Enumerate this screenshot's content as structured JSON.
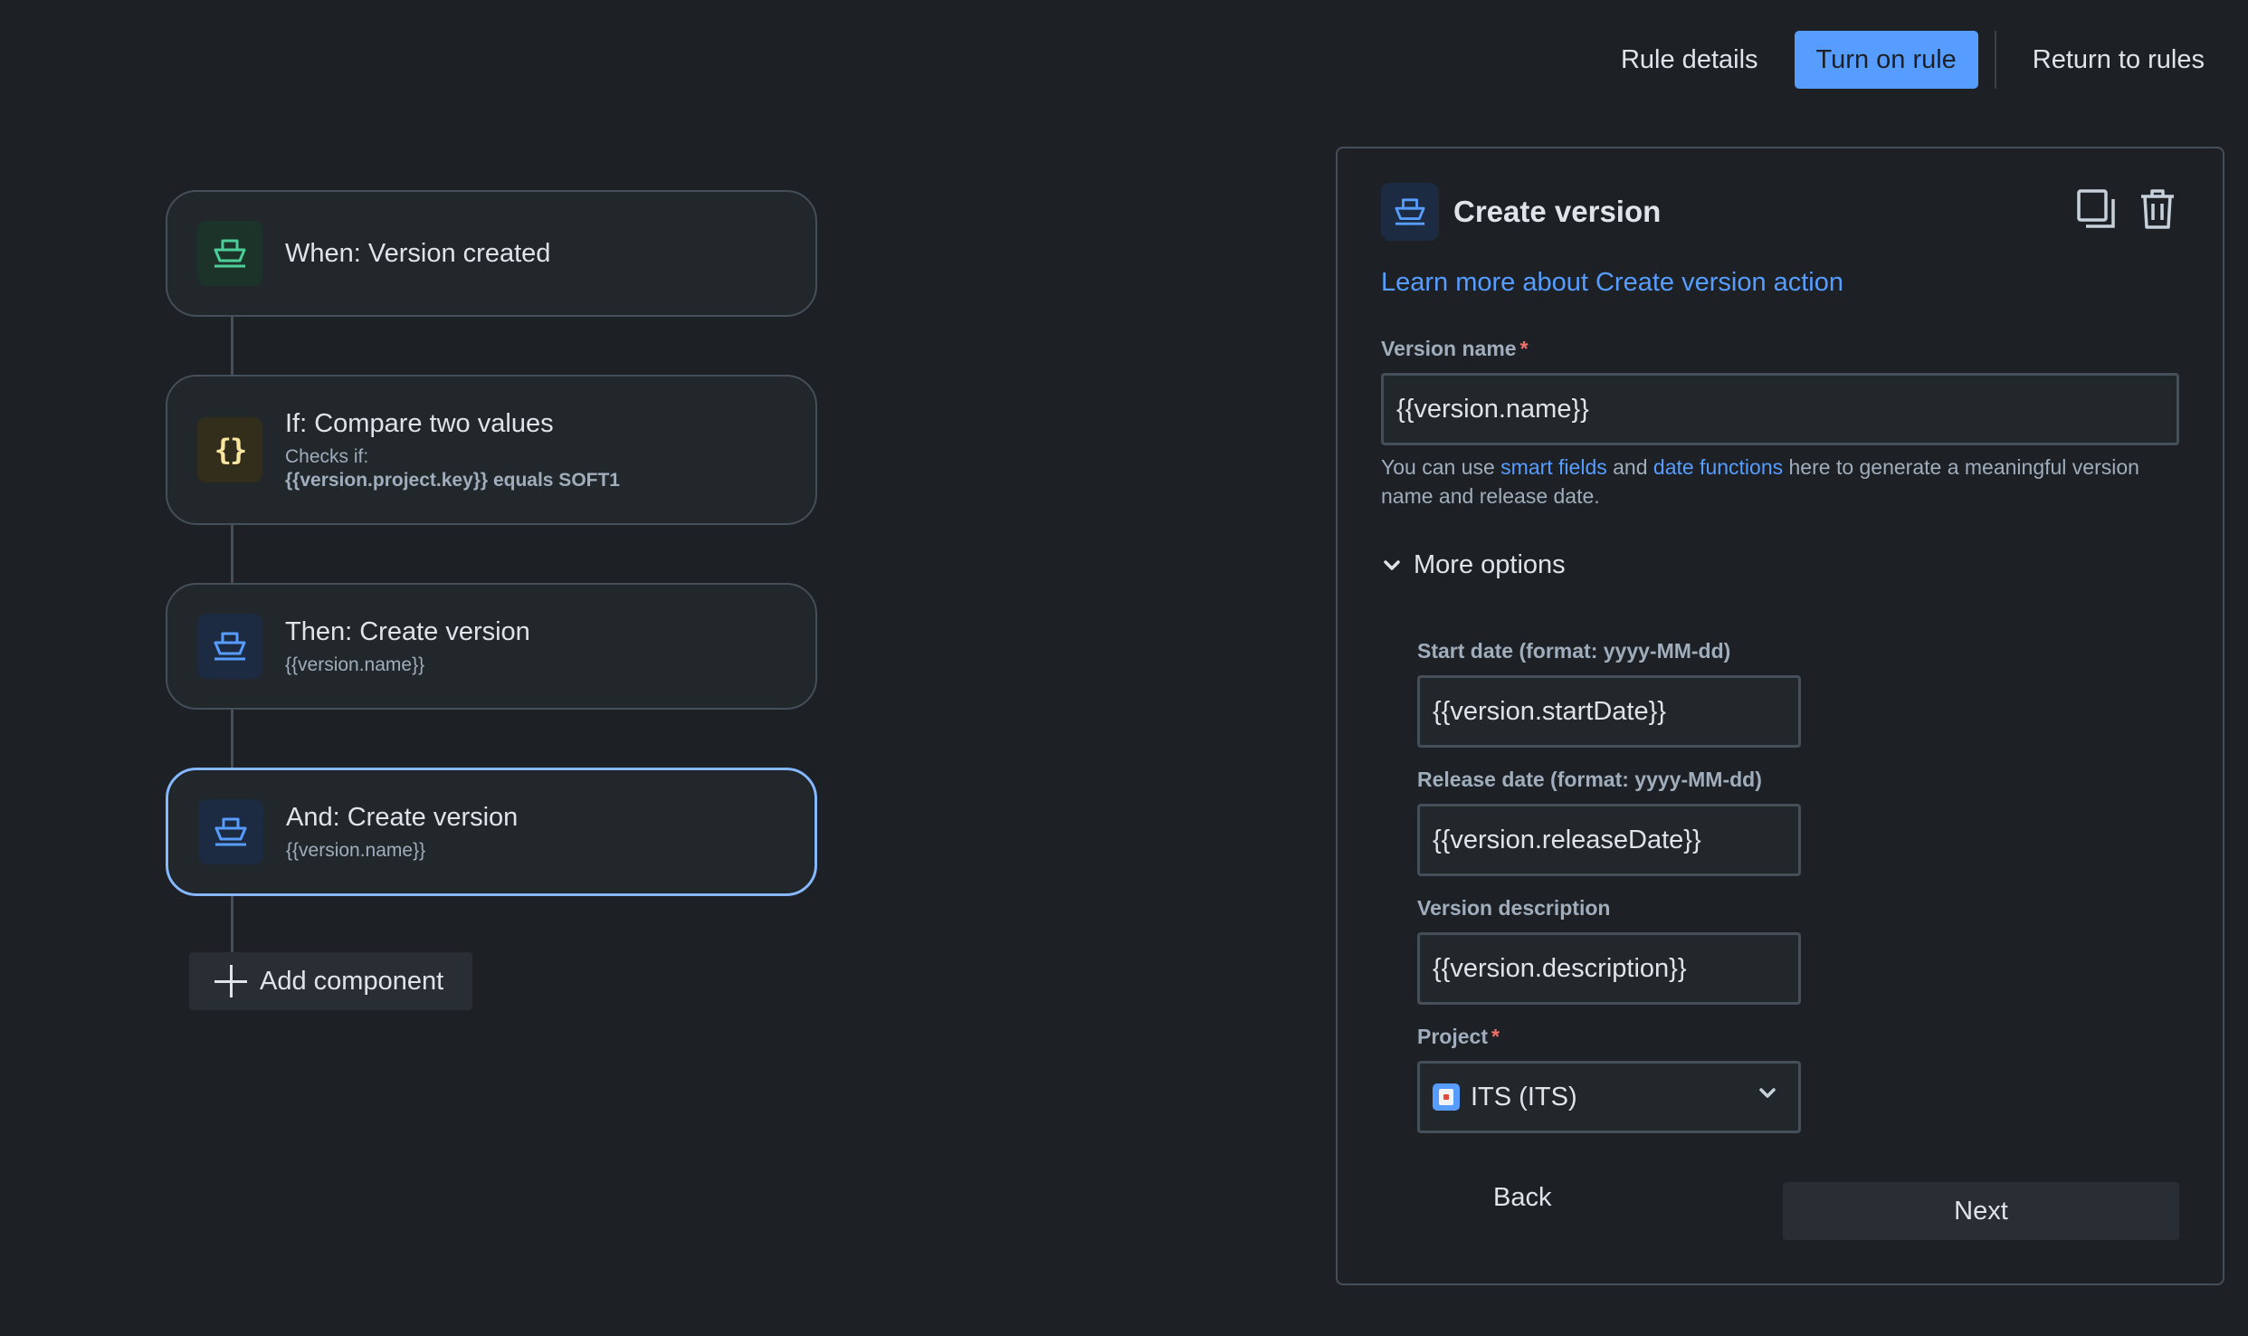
{
  "topbar": {
    "rule_details": "Rule details",
    "turn_on_rule": "Turn on rule",
    "return_to_rules": "Return to rules"
  },
  "flow": {
    "trigger": {
      "title": "When: Version created",
      "icon": "ship-icon",
      "color": "#4bce97"
    },
    "condition": {
      "title": "If: Compare two values",
      "subtitle": "Checks if:",
      "detail": "{{version.project.key}} equals SOFT1",
      "icon": "braces-icon",
      "color": "#f5cd47"
    },
    "action1": {
      "title": "Then: Create version",
      "subtitle": "{{version.name}}",
      "icon": "ship-icon",
      "color": "#579dff"
    },
    "action2": {
      "title": "And: Create version",
      "subtitle": "{{version.name}}",
      "icon": "ship-icon",
      "color": "#579dff",
      "selected": true
    },
    "add_component": "Add component"
  },
  "panel": {
    "title": "Create version",
    "learn_more": "Learn more about Create version action",
    "version_name": {
      "label": "Version name",
      "value": "{{version.name}}"
    },
    "help": {
      "pre": "You can use ",
      "link1": "smart fields",
      "mid": " and ",
      "link2": "date functions",
      "post": " here to generate a meaningful version name and release date."
    },
    "more_options": "More options",
    "start_date": {
      "label": "Start date (format: yyyy-MM-dd)",
      "value": "{{version.startDate}}"
    },
    "release_date": {
      "label": "Release date (format: yyyy-MM-dd)",
      "value": "{{version.releaseDate}}"
    },
    "description": {
      "label": "Version description",
      "value": "{{version.description}}"
    },
    "project": {
      "label": "Project",
      "value": "ITS (ITS)"
    },
    "back": "Back",
    "next": "Next"
  }
}
